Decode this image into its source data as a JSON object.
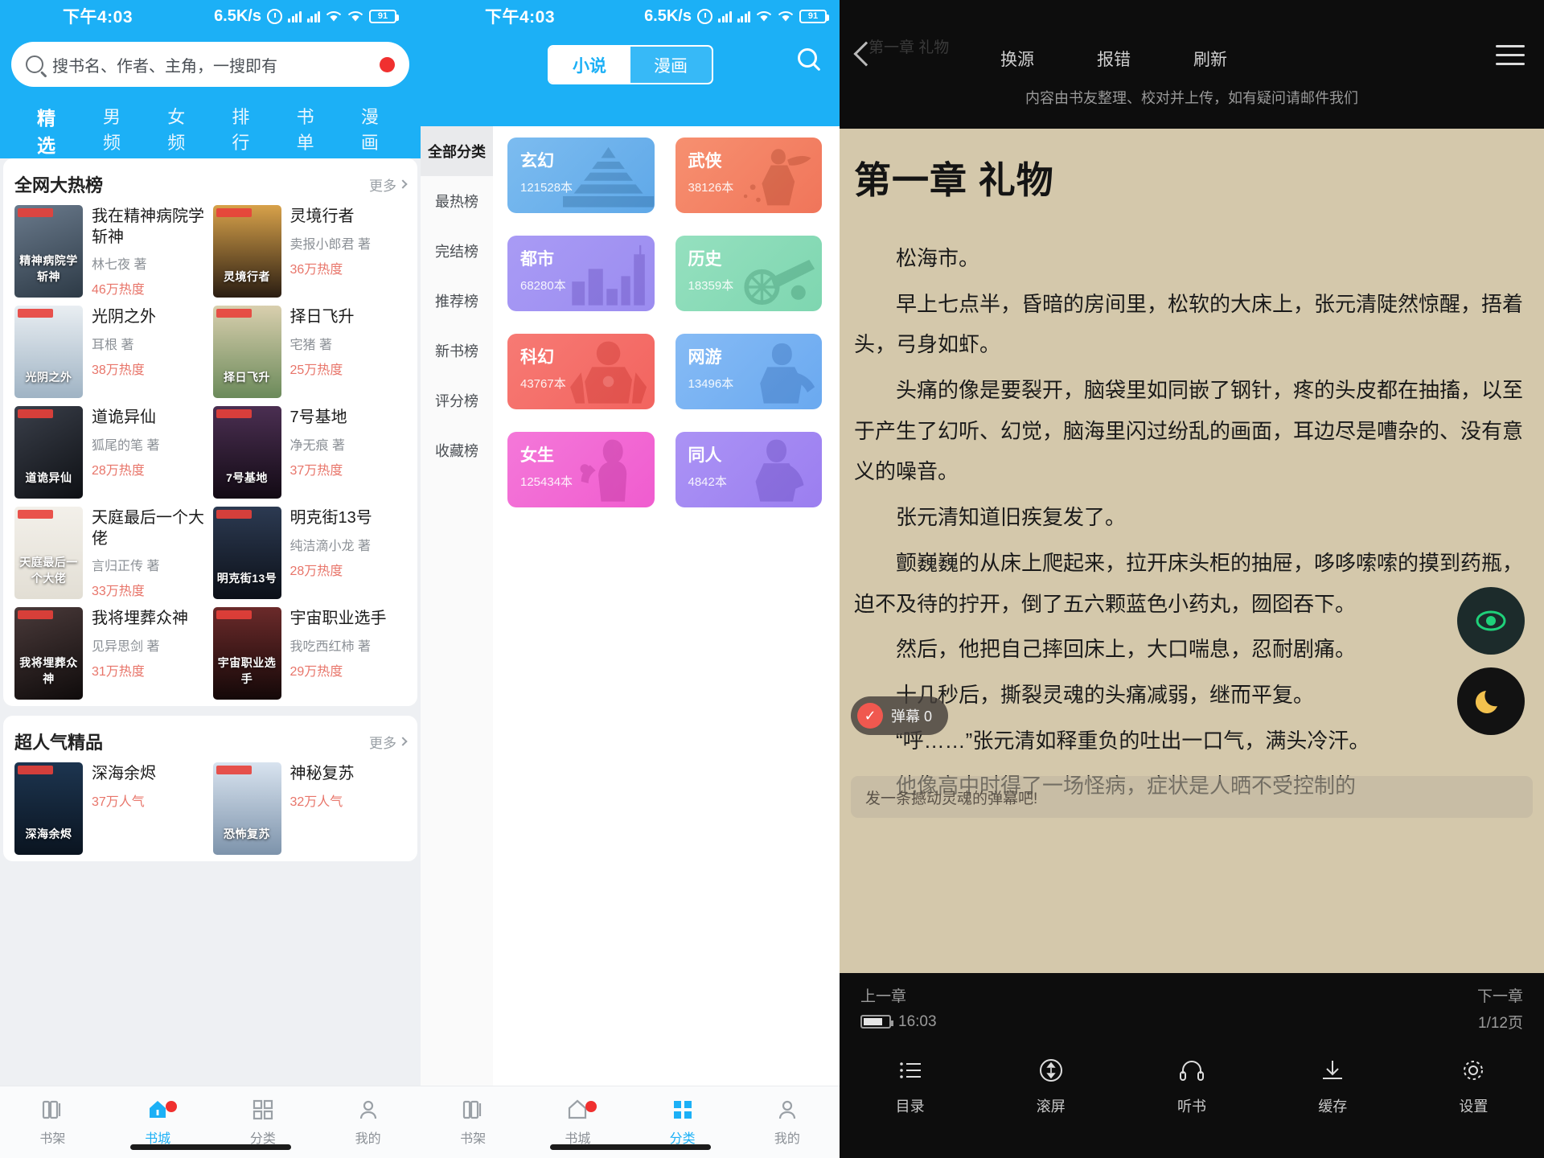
{
  "statusbar": {
    "time": "下午4:03",
    "speed": "6.5K/s",
    "battery": "91",
    "icons": [
      "alarm-icon",
      "signal-bars-icon",
      "signal-bars-icon",
      "wifi-icon",
      "wifi-icon",
      "battery-icon"
    ]
  },
  "panel_a": {
    "search": {
      "placeholder": "搜书名、作者、主角，一搜即有",
      "icon": "search-icon",
      "badge": ""
    },
    "tabs": [
      {
        "label": "精选",
        "active": true
      },
      {
        "label": "男频",
        "active": false
      },
      {
        "label": "女频",
        "active": false
      },
      {
        "label": "排行",
        "active": false
      },
      {
        "label": "书单",
        "active": false
      },
      {
        "label": "漫画",
        "active": false
      }
    ],
    "sections": [
      {
        "title": "全网大热榜",
        "more": "更多",
        "books": [
          {
            "name": "我在精神病院学斩神",
            "author": "林七夜 著",
            "heat": "46万热度",
            "cover_text": "精神病院学斩神",
            "cover_bg": "linear-gradient(160deg,#6a7a8c,#2d3a46)"
          },
          {
            "name": "灵境行者",
            "author": "卖报小郎君 著",
            "heat": "36万热度",
            "cover_text": "灵境行者",
            "cover_bg": "linear-gradient(180deg,#d8a24a,#2a1d12)"
          },
          {
            "name": "光阴之外",
            "author": "耳根 著",
            "heat": "38万热度",
            "cover_text": "光阴之外",
            "cover_bg": "linear-gradient(180deg,#e9eef2,#9fb3c4)"
          },
          {
            "name": "择日飞升",
            "author": "宅猪 著",
            "heat": "25万热度",
            "cover_text": "择日飞升",
            "cover_bg": "linear-gradient(180deg,#d9cfae,#6b8a5a)"
          },
          {
            "name": "道诡异仙",
            "author": "狐尾的笔 著",
            "heat": "28万热度",
            "cover_text": "道诡异仙",
            "cover_bg": "linear-gradient(150deg,#3a3f4a,#0e1014)"
          },
          {
            "name": "7号基地",
            "author": "净无痕 著",
            "heat": "37万热度",
            "cover_text": "7号基地",
            "cover_bg": "linear-gradient(180deg,#4b2f52,#120a14)"
          },
          {
            "name": "天庭最后一个大佬",
            "author": "言归正传 著",
            "heat": "33万热度",
            "cover_text": "天庭最后一个大佬",
            "cover_bg": "linear-gradient(180deg,#f3f0ea,#e2ded4)"
          },
          {
            "name": "明克街13号",
            "author": "纯洁滴小龙 著",
            "heat": "28万热度",
            "cover_text": "明克街13号",
            "cover_bg": "linear-gradient(180deg,#2c3a52,#0c1018)"
          },
          {
            "name": "我将埋葬众神",
            "author": "见异思剑 著",
            "heat": "31万热度",
            "cover_text": "我将埋葬众神",
            "cover_bg": "linear-gradient(160deg,#4a3a3a,#0f0b0b)"
          },
          {
            "name": "宇宙职业选手",
            "author": "我吃西红柿 著",
            "heat": "29万热度",
            "cover_text": "宇宙职业选手",
            "cover_bg": "linear-gradient(180deg,#6b2a2a,#140808)"
          }
        ]
      },
      {
        "title": "超人气精品",
        "more": "更多",
        "books": [
          {
            "name": "深海余烬",
            "author": "",
            "heat": "37万人气",
            "cover_text": "深海余烬",
            "cover_bg": "linear-gradient(180deg,#1d3550,#0a1420)"
          },
          {
            "name": "神秘复苏",
            "author": "",
            "heat": "32万人气",
            "cover_text": "恐怖复苏",
            "cover_bg": "linear-gradient(180deg,#d8e3ef,#7d93ab)"
          }
        ]
      }
    ],
    "bottom_nav": [
      {
        "label": "书架",
        "icon": "bookshelf-icon",
        "active": false,
        "badge": false
      },
      {
        "label": "书城",
        "icon": "home-icon",
        "active": true,
        "badge": true
      },
      {
        "label": "分类",
        "icon": "grid-icon",
        "active": false,
        "badge": false
      },
      {
        "label": "我的",
        "icon": "person-icon",
        "active": false,
        "badge": false
      }
    ]
  },
  "panel_b": {
    "segments": [
      {
        "label": "小说",
        "active": true
      },
      {
        "label": "漫画",
        "active": false
      }
    ],
    "search_icon": "search-icon",
    "sidebar": [
      {
        "label": "全部分类",
        "active": true
      },
      {
        "label": "最热榜",
        "active": false
      },
      {
        "label": "完结榜",
        "active": false
      },
      {
        "label": "推荐榜",
        "active": false
      },
      {
        "label": "新书榜",
        "active": false
      },
      {
        "label": "评分榜",
        "active": false
      },
      {
        "label": "收藏榜",
        "active": false
      }
    ],
    "categories": [
      {
        "name": "玄幻",
        "count": "121528本",
        "color": "#5fa8e8",
        "color2": "#7cbcf0",
        "art": "pagoda-icon"
      },
      {
        "name": "武侠",
        "count": "38126本",
        "color": "#f0755a",
        "color2": "#f79070",
        "art": "swordsman-icon"
      },
      {
        "name": "都市",
        "count": "68280本",
        "color": "#9b8cf0",
        "color2": "#a99bf5",
        "art": "city-icon"
      },
      {
        "name": "历史",
        "count": "18359本",
        "color": "#7ed6b0",
        "color2": "#95e0bf",
        "art": "cannon-icon"
      },
      {
        "name": "科幻",
        "count": "43767本",
        "color": "#f2645f",
        "color2": "#f77a74",
        "art": "robot-icon"
      },
      {
        "name": "网游",
        "count": "13496本",
        "color": "#6aa9f0",
        "color2": "#86bbf5",
        "art": "gamer-icon"
      },
      {
        "name": "女生",
        "count": "125434本",
        "color": "#f05ccf",
        "color2": "#f478d9",
        "art": "girl-icon"
      },
      {
        "name": "同人",
        "count": "4842本",
        "color": "#9b7ef0",
        "color2": "#ab93f5",
        "art": "figure-icon"
      }
    ],
    "bottom_nav": [
      {
        "label": "书架",
        "icon": "bookshelf-icon",
        "active": false,
        "badge": false
      },
      {
        "label": "书城",
        "icon": "home-icon",
        "active": false,
        "badge": true
      },
      {
        "label": "分类",
        "icon": "grid-icon",
        "active": true,
        "badge": false
      },
      {
        "label": "我的",
        "icon": "person-icon",
        "active": false,
        "badge": false
      }
    ]
  },
  "panel_c": {
    "header": {
      "chapter_small": "第一章 礼物",
      "back_icon": "back-chevron-icon",
      "actions": [
        {
          "label": "换源"
        },
        {
          "label": "报错"
        },
        {
          "label": "刷新"
        }
      ],
      "menu_icon": "hamburger-menu-icon",
      "note": "内容由书友整理、校对并上传，如有疑问请邮件我们"
    },
    "chapter_title": "第一章 礼物",
    "paragraphs": [
      "松海市。",
      "早上七点半，昏暗的房间里，松软的大床上，张元清陡然惊醒，捂着头，弓身如虾。",
      "头痛的像是要裂开，脑袋里如同嵌了钢针，疼的头皮都在抽搐，以至于产生了幻听、幻觉，脑海里闪过纷乱的画面，耳边尽是嘈杂的、没有意义的噪音。",
      "张元清知道旧疾复发了。",
      "颤巍巍的从床上爬起来，拉开床头柜的抽屉，哆哆嗦嗦的摸到药瓶，迫不及待的拧开，倒了五六颗蓝色小药丸，囫囵吞下。",
      "然后，他把自己摔回床上，大口喘息，忍耐剧痛。",
      "十几秒后，撕裂灵魂的头痛减弱，继而平复。",
      "“呼……”张元清如释重负的吐出一口气，满头冷汗。",
      "他像高中时得了一场怪病，症状是人晒不受控制的"
    ],
    "fab_eye": "eye-icon",
    "fab_moon": "moon-icon",
    "danmu": {
      "label": "弹幕 0",
      "check_icon": "check-circle-icon"
    },
    "danmu_input_placeholder": "发一条撼动灵魂的弹幕吧!",
    "footer": {
      "prev_chapter": "上一章",
      "next_chapter": "下一章",
      "battery_time": "16:03",
      "page_indicator": "1/12页",
      "tools": [
        {
          "label": "目录",
          "icon": "list-icon"
        },
        {
          "label": "滚屏",
          "icon": "scroll-icon"
        },
        {
          "label": "听书",
          "icon": "headphone-icon"
        },
        {
          "label": "缓存",
          "icon": "download-icon"
        },
        {
          "label": "设置",
          "icon": "gear-icon"
        }
      ]
    }
  }
}
